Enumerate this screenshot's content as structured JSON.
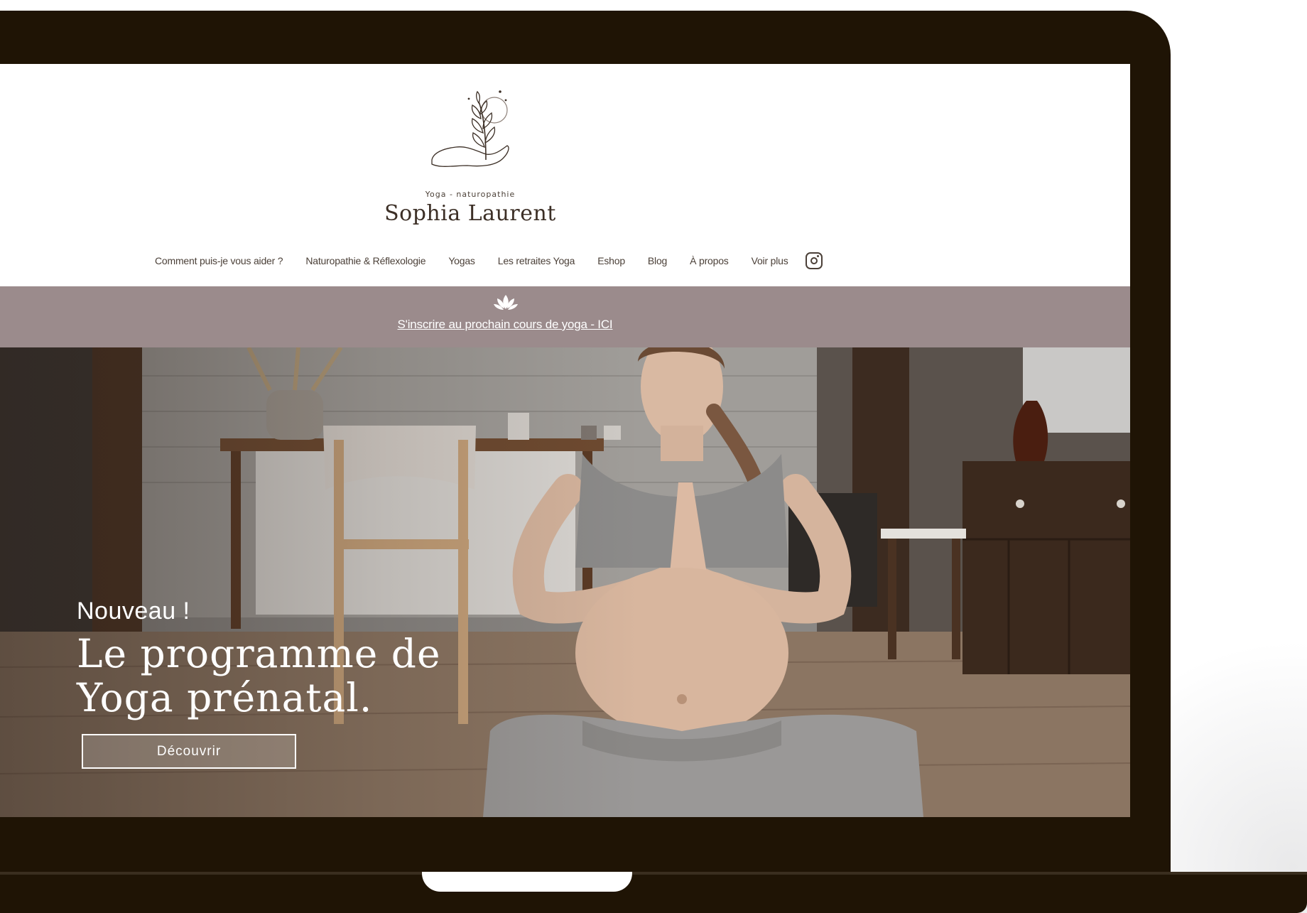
{
  "brand": {
    "tagline": "Yoga - naturopathie",
    "name": "Sophia Laurent",
    "logo_icon": "hand-holding-leaf-icon"
  },
  "nav": {
    "items": [
      {
        "label": "Comment puis-je vous aider ?"
      },
      {
        "label": "Naturopathie & Réflexologie"
      },
      {
        "label": "Yogas"
      },
      {
        "label": "Les retraites Yoga"
      },
      {
        "label": "Eshop"
      },
      {
        "label": "Blog"
      },
      {
        "label": "À propos"
      },
      {
        "label": "Voir plus"
      }
    ],
    "social_icon": "instagram-icon"
  },
  "announcement": {
    "icon": "lotus-icon",
    "link_text": "S'inscrire au prochain cours de yoga - ICI"
  },
  "hero": {
    "kicker": "Nouveau !",
    "title_line1": "Le programme de",
    "title_line2": "Yoga prénatal.",
    "cta_label": "Découvrir"
  },
  "colors": {
    "device": "#1f1405",
    "announcement_bg": "#9b8b8c",
    "text_dark": "#4b4038"
  }
}
